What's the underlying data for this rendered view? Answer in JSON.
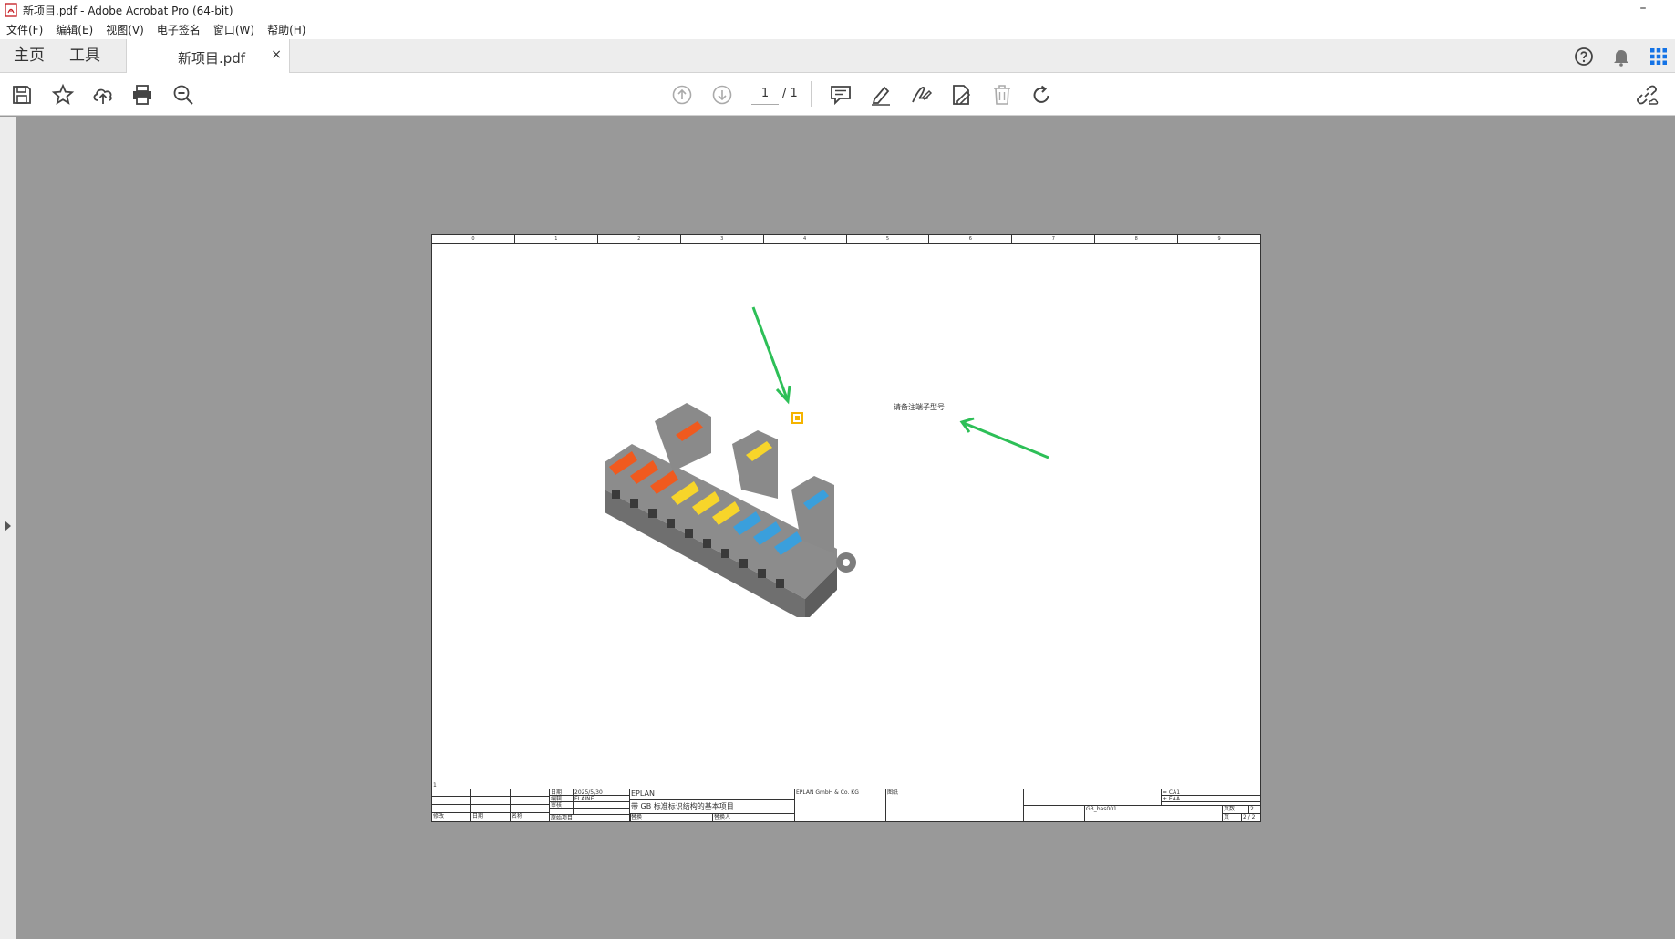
{
  "window": {
    "title": "新项目.pdf - Adobe Acrobat Pro (64-bit)",
    "minimize": "–"
  },
  "menu": [
    "文件(F)",
    "编辑(E)",
    "视图(V)",
    "电子签名",
    "窗口(W)",
    "帮助(H)"
  ],
  "tabs": {
    "home": "主页",
    "tools": "工具",
    "document": "新项目.pdf",
    "close": "×"
  },
  "toolbar": {
    "current_page": "1",
    "total_pages": "/ 1"
  },
  "colors": {
    "accent_green": "#2dbf57",
    "comment_yellow": "#f5b400",
    "workspace_gray": "#999999"
  },
  "document": {
    "column_numbers": [
      "0",
      "1",
      "2",
      "3",
      "4",
      "5",
      "6",
      "7",
      "8",
      "9"
    ],
    "note": "请备注端子型号",
    "row_marker": "1",
    "title_block": {
      "date_label": "日期",
      "date_value": "2025/5/30",
      "edit_label": "编辑",
      "editor_value": "ELAINE",
      "review_label": "审核",
      "brand": "EPLAN",
      "project_title": "带 GB 标准标识结构的基本项目",
      "company": "EPLAN GmbH & Co. KG",
      "drawing_label": "图纸",
      "eq_line_1": "= CA1",
      "eq_line_2": "+ EAA",
      "drawing_no": "GB_bas001",
      "page_label": "页数",
      "page_count": "2",
      "sheet_label": "页",
      "sheet_value": "2 / 2",
      "modify": "修改",
      "date2": "日期",
      "name": "名称",
      "original": "原始项目",
      "replace": "替换",
      "replaced_by": "替换人"
    }
  }
}
